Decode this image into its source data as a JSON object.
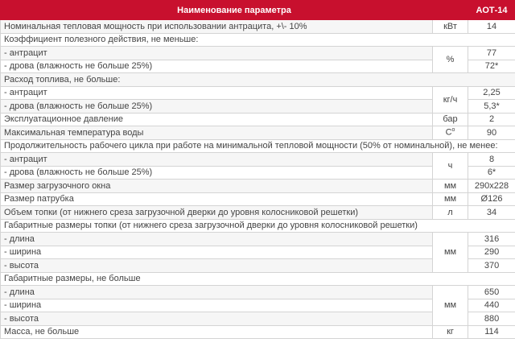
{
  "header": {
    "param": "Наименование параметра",
    "model": "АОТ-14"
  },
  "rows": {
    "power": {
      "label": "Номинальная тепловая мощность при использовании антрацита, +\\- 10%",
      "unit": "кВт",
      "value": "14"
    },
    "efficiency": {
      "label": "Коэффициент полезного действия, не меньше:",
      "unit": "%",
      "anthracite": {
        "label": "- антрацит",
        "value": "77"
      },
      "wood": {
        "label": "- дрова (влажность не больше 25%)",
        "value": "72*"
      }
    },
    "consumption": {
      "label": "Расход топлива, не больше:",
      "unit": "кг/ч",
      "anthracite": {
        "label": "- антрацит",
        "value": "2,25"
      },
      "wood": {
        "label": "- дрова (влажность не больше 25%)",
        "value": "5,3*"
      }
    },
    "pressure": {
      "label": "Эксплуатационное давление",
      "unit": "бар",
      "value": "2"
    },
    "temperature": {
      "label": "Максимальная температура воды",
      "unit": "С",
      "unit_sup": "о",
      "value": "90"
    },
    "duration": {
      "label": "Продолжительность рабочего цикла при работе на минимальной тепловой мощности (50% от номинальной), не менее:",
      "unit": "ч",
      "anthracite": {
        "label": "- антрацит",
        "value": "8"
      },
      "wood": {
        "label": "- дрова (влажность не больше 25%)",
        "value": "6*"
      }
    },
    "load_window": {
      "label": "Размер загрузочного окна",
      "unit": "мм",
      "value": "290х228"
    },
    "pipe": {
      "label": "Размер патрубка",
      "unit": "мм",
      "value": "Ø126"
    },
    "firebox_volume": {
      "label": "Объем топки (от нижнего среза загрузочной дверки до уровня колосниковой решетки)",
      "unit": "л",
      "value": "34"
    },
    "firebox_dims": {
      "label": "Габаритные размеры топки (от нижнего среза загрузочной дверки до уровня колосниковой решетки)",
      "unit": "мм",
      "length": {
        "label": "- длина",
        "value": "316"
      },
      "width": {
        "label": "- ширина",
        "value": "290"
      },
      "height": {
        "label": "- высота",
        "value": "370"
      }
    },
    "overall_dims": {
      "label": "Габаритные размеры, не больше",
      "unit": "мм",
      "length": {
        "label": "- длина",
        "value": "650"
      },
      "width": {
        "label": "- ширина",
        "value": "440"
      },
      "height": {
        "label": "- высота",
        "value": "880"
      }
    },
    "mass": {
      "label": "Масса, не больше",
      "unit": "кг",
      "value": "114"
    }
  },
  "colors": {
    "header_bg": "#c8102e",
    "header_text": "#ffffff",
    "text": "#444444",
    "border": "#d4d4d4"
  }
}
